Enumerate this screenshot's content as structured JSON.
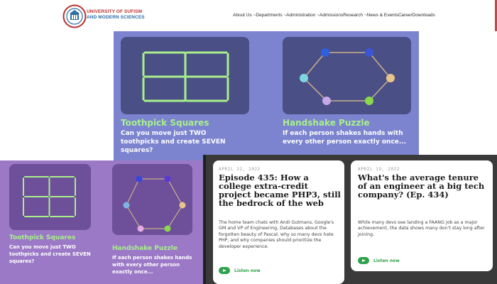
{
  "header": {
    "logo_name_line1": "UNIVERSITY OF SUFISM",
    "logo_name_line2": "AND MODERN SCIENCES",
    "nav": [
      "About Us",
      "~Departments",
      "~Administration",
      "~Admissions",
      "Research",
      "~News & Events",
      "Career",
      "Downloads"
    ]
  },
  "puzzles": [
    {
      "title": "Toothpick Squares",
      "text": "Can you move just TWO toothpicks and create SEVEN squares?",
      "icon": "toothpick-grid-icon"
    },
    {
      "title": "Handshake Puzzle",
      "text": "If each person shakes hands with every other person exactly once...",
      "icon": "handshake-hexagon-icon"
    }
  ],
  "episodes": [
    {
      "date": "APRIL 22, 2022",
      "title": "Episode 435: How a college extra-credit project became PHP3, still the bedrock of the web",
      "body": "The home team chats with Andi Gutmans, Google's GM and VP of Engineering, Databases about the forgotten beauty of Pascal, why so many devs hate PHP, and why companies should prioritize the developer experience.",
      "listen": "Listen now"
    },
    {
      "date": "APRIL 19, 2022",
      "title": "What's the average tenure of an engineer at a big tech company? (Ep. 434)",
      "body": "While many devs see landing a FAANG job as a major achievement, the data shows many don't stay long after joining.",
      "listen": "Listen now"
    }
  ],
  "colors": {
    "big_panel": "#7c84cf",
    "small_panel": "#9b79c6",
    "tile": "#4a4f86",
    "puzzle_title": "#a8f08a",
    "listen_green": "#2fa24a",
    "dark_bg": "#3a3a3a"
  }
}
